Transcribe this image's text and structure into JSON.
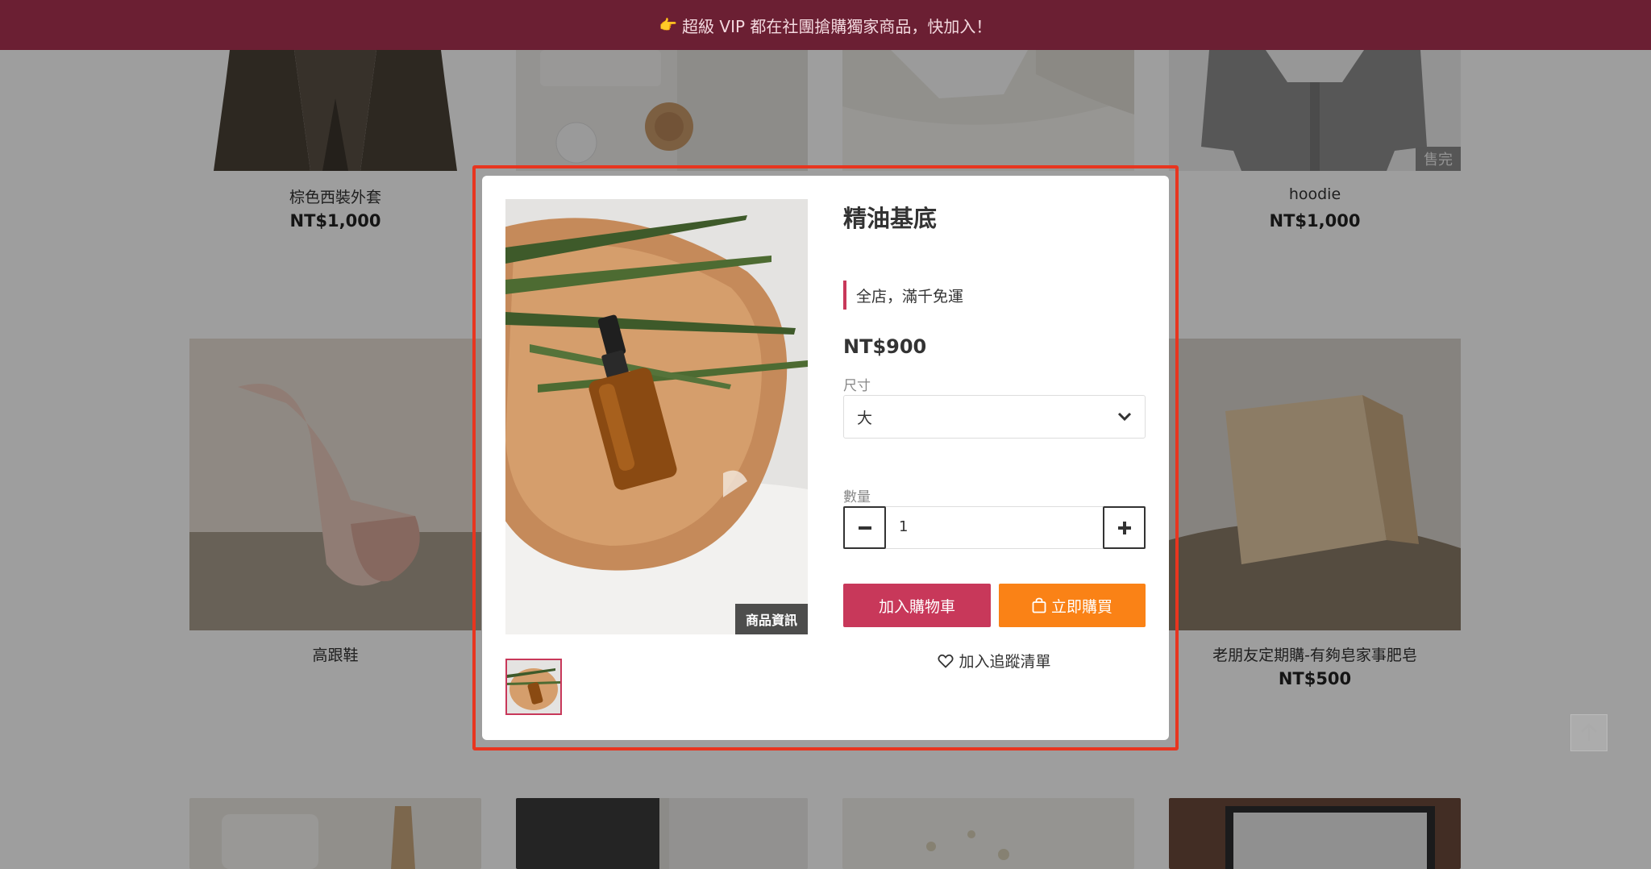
{
  "announcement": {
    "text": "超級 VIP 都在社團搶購獨家商品，快加入！"
  },
  "products": [
    {
      "name": "棕色西裝外套",
      "price": "NT$1,000"
    },
    {
      "name": "hoodie",
      "price": "NT$1,000",
      "badge": "售完"
    },
    {
      "name": "高跟鞋",
      "price": ""
    },
    {
      "name": "老朋友定期購-有夠皂家事肥皂",
      "price": "NT$500"
    }
  ],
  "modal": {
    "title": "精油基底",
    "promo": "全店，滿千免運",
    "price": "NT$900",
    "image_tag": "商品資訊",
    "size_label": "尺寸",
    "size_value": "大",
    "quantity_label": "數量",
    "quantity_value": "1",
    "add_to_cart": "加入購物車",
    "buy_now": "立即購買",
    "wishlist": "加入追蹤清單"
  },
  "colors": {
    "announcement_bg": "#6b1f33",
    "accent": "#c8385a",
    "buy_button": "#fa8216",
    "highlight": "#e8351f"
  },
  "icons": [
    "pointing-hand-icon",
    "chevron-down-icon",
    "minus-icon",
    "plus-icon",
    "shopping-bag-icon",
    "heart-icon",
    "arrow-up-icon"
  ]
}
